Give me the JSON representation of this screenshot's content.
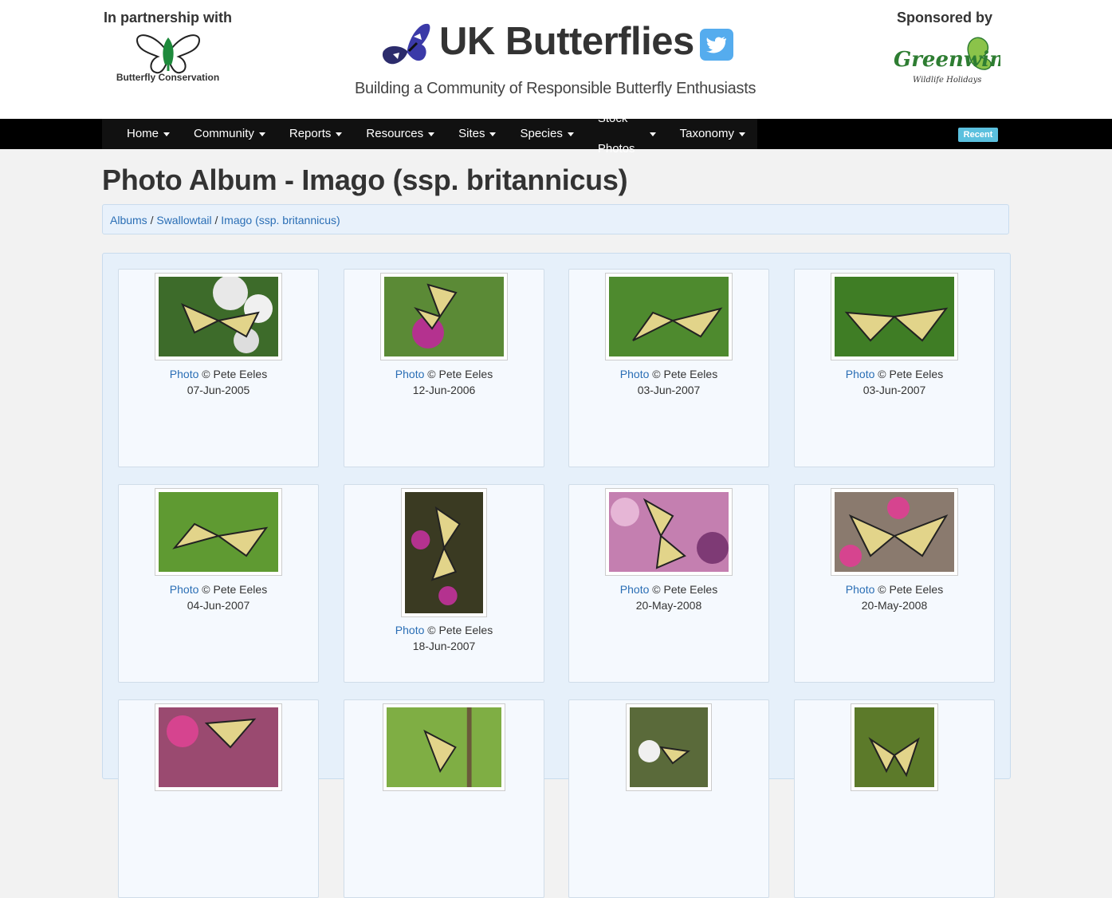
{
  "header": {
    "partner_caption": "In partnership with",
    "partner_name": "Butterfly Conservation",
    "site_title": "UK Butterflies",
    "tagline": "Building a Community of Responsible Butterfly Enthusiasts",
    "sponsor_caption": "Sponsored by",
    "sponsor_name": "Greenwings",
    "sponsor_sub": "Wildlife Holidays"
  },
  "nav": {
    "items": [
      "Home",
      "Community",
      "Reports",
      "Resources",
      "Sites",
      "Species",
      "Stock Photos",
      "Taxonomy"
    ],
    "recent_label": "Recent"
  },
  "page": {
    "title": "Photo Album - Imago (ssp. britannicus)",
    "breadcrumb": [
      "Albums",
      "Swallowtail",
      "Imago (ssp. britannicus)"
    ]
  },
  "photos": [
    {
      "link": "Photo",
      "credit": "© Pete Eeles",
      "date": "07-Jun-2005"
    },
    {
      "link": "Photo",
      "credit": "© Pete Eeles",
      "date": "12-Jun-2006"
    },
    {
      "link": "Photo",
      "credit": "© Pete Eeles",
      "date": "03-Jun-2007"
    },
    {
      "link": "Photo",
      "credit": "© Pete Eeles",
      "date": "03-Jun-2007"
    },
    {
      "link": "Photo",
      "credit": "© Pete Eeles",
      "date": "04-Jun-2007"
    },
    {
      "link": "Photo",
      "credit": "© Pete Eeles",
      "date": "18-Jun-2007"
    },
    {
      "link": "Photo",
      "credit": "© Pete Eeles",
      "date": "20-May-2008"
    },
    {
      "link": "Photo",
      "credit": "© Pete Eeles",
      "date": "20-May-2008"
    },
    {
      "link": "",
      "credit": "",
      "date": ""
    },
    {
      "link": "",
      "credit": "",
      "date": ""
    },
    {
      "link": "",
      "credit": "",
      "date": ""
    },
    {
      "link": "",
      "credit": "",
      "date": ""
    }
  ],
  "colors": {
    "link": "#2a6eb5",
    "nav_bg": "#000000",
    "recent_badge": "#5bc0de",
    "twitter": "#55acee"
  }
}
